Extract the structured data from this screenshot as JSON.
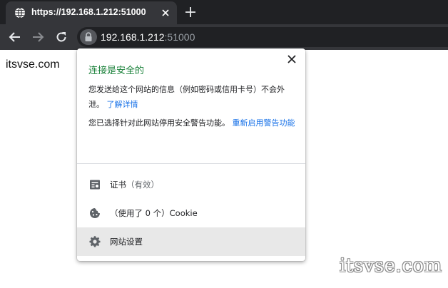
{
  "tab": {
    "title": "https://192.168.1.212:51000"
  },
  "address_bar": {
    "host": "192.168.1.212",
    "port": ":51000"
  },
  "page": {
    "body_text": "itsvse.com"
  },
  "popup": {
    "title": "连接是安全的",
    "info_text": "您发送给这个网站的信息（例如密码或信用卡号）不会外泄。",
    "learn_more_link": "了解详情",
    "warning_text": "您已选择针对此网站停用安全警告功能。",
    "reenable_link": "重新启用警告功能",
    "rows": [
      {
        "label": "证书",
        "sub": "（有效）",
        "icon": "certificate-icon"
      },
      {
        "label": "（使用了 0 个）Cookie",
        "sub": "",
        "icon": "cookie-icon"
      },
      {
        "label": "网站设置",
        "sub": "",
        "icon": "gear-icon"
      }
    ]
  },
  "watermark": "itsvse.com",
  "colors": {
    "secure_title": "#188038",
    "link": "#1a73e8",
    "tab_bar": "#202124",
    "toolbar": "#35363a"
  }
}
